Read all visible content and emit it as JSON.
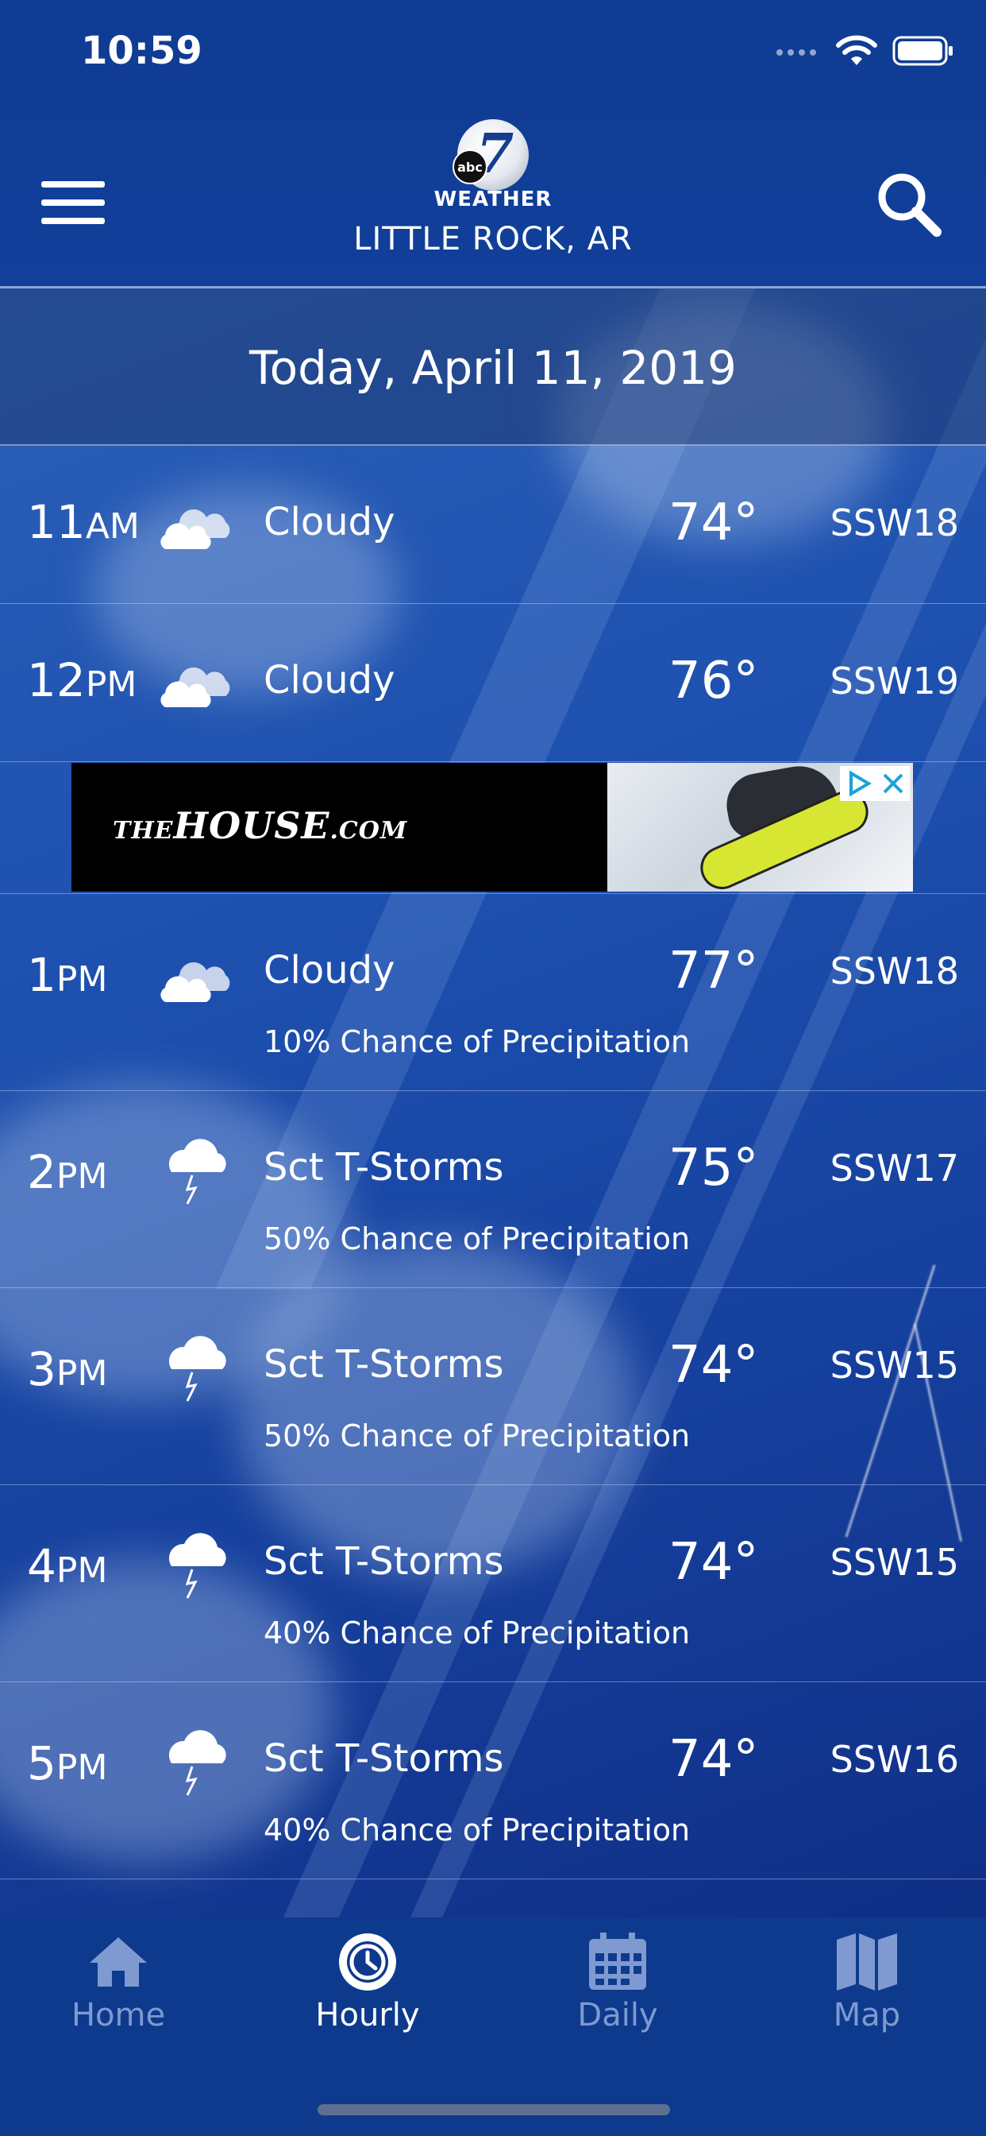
{
  "status_bar": {
    "time": "10:59"
  },
  "header": {
    "logo_text": "WEATHER",
    "logo_number": "7",
    "logo_network": "abc",
    "location": "LITTLE ROCK, AR",
    "menu_icon": "hamburger-menu-icon",
    "search_icon": "search-icon"
  },
  "date_label": "Today, April 11, 2019",
  "hourly": [
    {
      "hour": "11",
      "period": "AM",
      "icon": "cloudy-icon",
      "condition": "Cloudy",
      "temp": "74°",
      "wind": "SSW18",
      "precip": ""
    },
    {
      "hour": "12",
      "period": "PM",
      "icon": "cloudy-icon",
      "condition": "Cloudy",
      "temp": "76°",
      "wind": "SSW19",
      "precip": ""
    },
    {
      "hour": "1",
      "period": "PM",
      "icon": "cloudy-icon",
      "condition": "Cloudy",
      "temp": "77°",
      "wind": "SSW18",
      "precip": "10% Chance of Precipitation"
    },
    {
      "hour": "2",
      "period": "PM",
      "icon": "thunderstorm-icon",
      "condition": "Sct T-Storms",
      "temp": "75°",
      "wind": "SSW17",
      "precip": "50% Chance of Precipitation"
    },
    {
      "hour": "3",
      "period": "PM",
      "icon": "thunderstorm-icon",
      "condition": "Sct T-Storms",
      "temp": "74°",
      "wind": "SSW15",
      "precip": "50% Chance of Precipitation"
    },
    {
      "hour": "4",
      "period": "PM",
      "icon": "thunderstorm-icon",
      "condition": "Sct T-Storms",
      "temp": "74°",
      "wind": "SSW15",
      "precip": "40% Chance of Precipitation"
    },
    {
      "hour": "5",
      "period": "PM",
      "icon": "thunderstorm-icon",
      "condition": "Sct T-Storms",
      "temp": "74°",
      "wind": "SSW16",
      "precip": "40% Chance of Precipitation"
    }
  ],
  "ad": {
    "brand_prefix": "THE",
    "brand_main": "HOUSE",
    "brand_suffix": ".COM"
  },
  "tabs": [
    {
      "label": "Home",
      "icon": "home-icon",
      "active": false
    },
    {
      "label": "Hourly",
      "icon": "clock-icon",
      "active": true
    },
    {
      "label": "Daily",
      "icon": "calendar-icon",
      "active": false
    },
    {
      "label": "Map",
      "icon": "map-icon",
      "active": false
    }
  ],
  "colors": {
    "header_bg": "#0f3b93",
    "tabbar_bg": "#0e3a8d",
    "tab_inactive": "#7f9ad0",
    "tab_active": "#ffffff"
  }
}
